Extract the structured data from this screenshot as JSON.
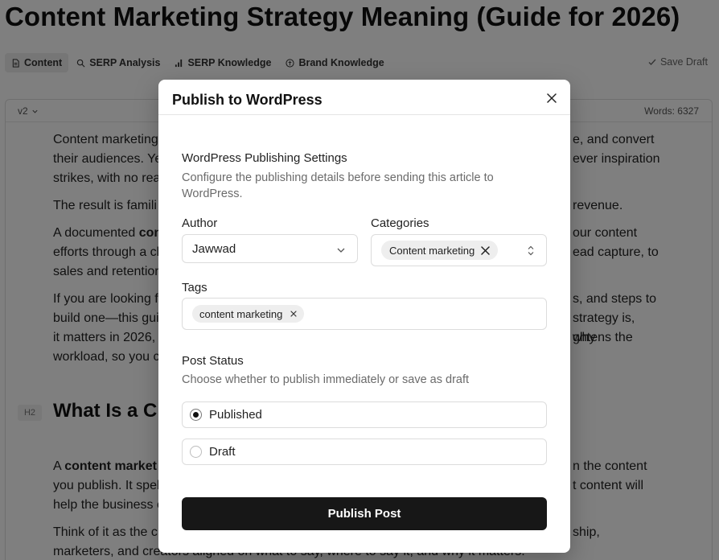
{
  "page": {
    "title": "Content Marketing Strategy Meaning (Guide for 2026)",
    "tabs": [
      {
        "label": "Content",
        "icon": "document-icon",
        "active": true
      },
      {
        "label": "SERP Analysis",
        "icon": "search-icon",
        "active": false
      },
      {
        "label": "SERP Knowledge",
        "icon": "bar-chart-icon",
        "active": false
      },
      {
        "label": "Brand Knowledge",
        "icon": "brand-icon",
        "active": false
      }
    ],
    "save_draft": "Save Draft"
  },
  "editor": {
    "version": "v2",
    "words": "Words: 6327",
    "p1": {
      "a": "Content marketing",
      "b": "e, and convert",
      "c": "their audiences. Ye",
      "d": "ever inspiration",
      "e": "strikes, with no rea"
    },
    "p2": {
      "a": "The result is famili",
      "b": "revenue."
    },
    "p3": {
      "a": "A documented ",
      "a_bold": "con",
      "b": "our content",
      "c": "efforts through a cl",
      "d": "ead capture, to",
      "e": "sales and retention"
    },
    "p4": {
      "a": "If you are looking f",
      "b": "s, and steps to",
      "c": "build one—this gui",
      "d": "strategy is, why",
      "e": "it matters in 2026,",
      "f": "ghtens the",
      "g": "workload, so you c"
    },
    "h2_tag": "H2",
    "h2": "What Is a C",
    "p5": {
      "a": "A ",
      "a_bold": "content market",
      "b": "n the content",
      "c": "you publish. It spel",
      "d": "t content will",
      "e": "help the business c"
    },
    "p6": {
      "a": "Think of it as the c",
      "b": "ship,",
      "c": "marketers, and creators aligned on what to say, where to say it, and why it matters."
    }
  },
  "modal": {
    "title": "Publish to WordPress",
    "settings_title": "WordPress Publishing Settings",
    "settings_desc": "Configure the publishing details before sending this article to WordPress.",
    "author_label": "Author",
    "author_value": "Jawwad",
    "categories_label": "Categories",
    "category_chip": "Content marketing",
    "tags_label": "Tags",
    "tag_chip": "content marketing",
    "status_label": "Post Status",
    "status_desc": "Choose whether to publish immediately or save as draft",
    "status_options": [
      {
        "label": "Published",
        "checked": true
      },
      {
        "label": "Draft",
        "checked": false
      }
    ],
    "publish_button": "Publish Post"
  }
}
